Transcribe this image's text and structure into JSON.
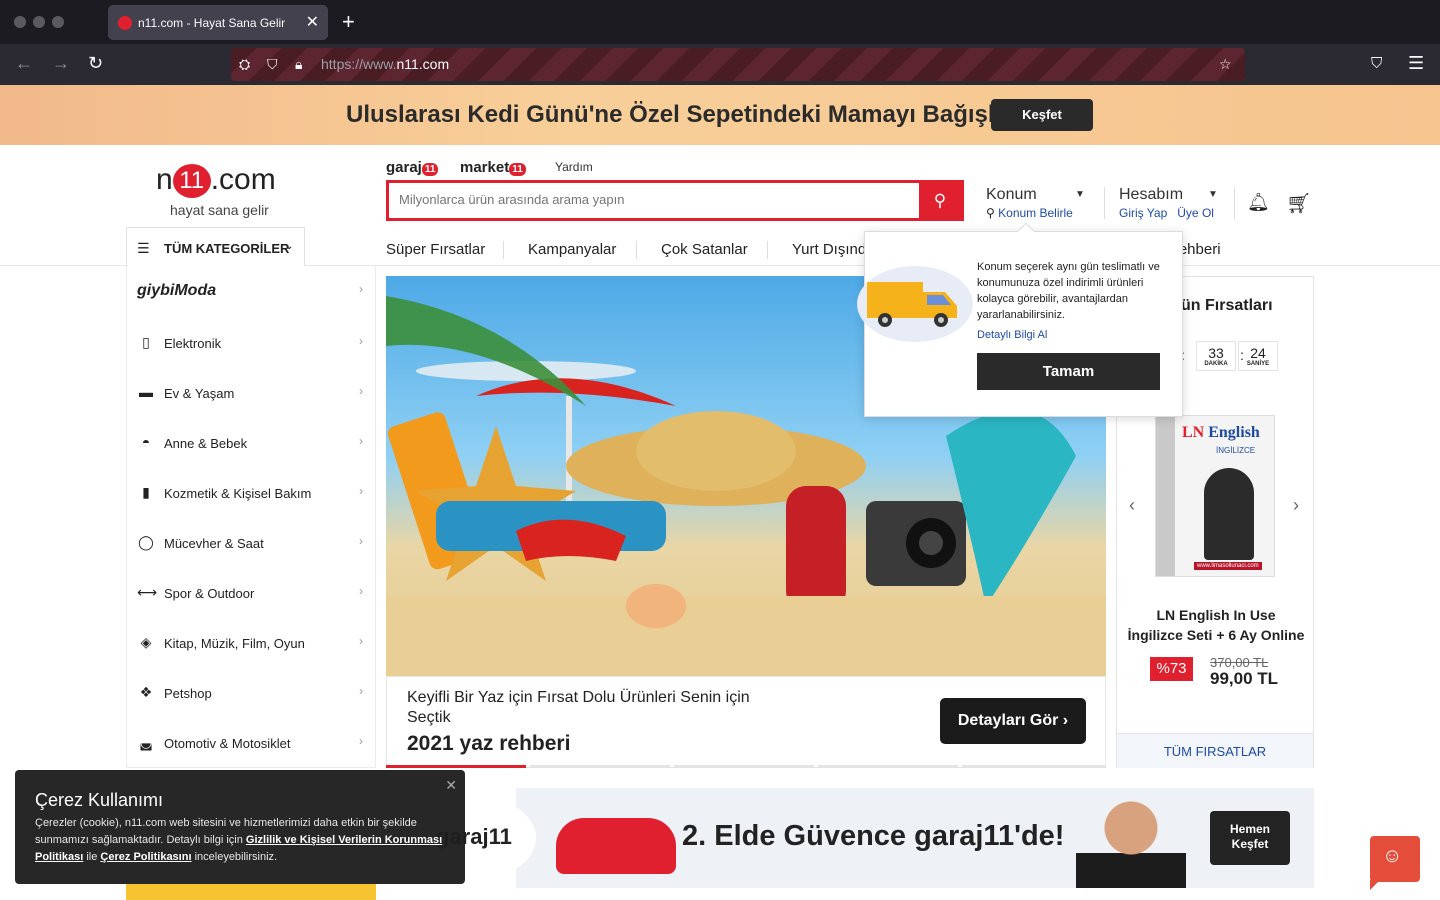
{
  "browser": {
    "tab_title": "n11.com - Hayat Sana Gelir",
    "url_prefix": "https://www.",
    "url_domain": "n11.com"
  },
  "promo": {
    "text": "Uluslarası Kedi Günü'ne Özel Sepetindeki Mamayı Bağışla",
    "button": "Keşfet"
  },
  "header": {
    "logo_left": "n",
    "logo_mid": "11",
    "logo_right": ".com",
    "slogan": "hayat sana gelir",
    "link_garaj": "garaj",
    "link_market": "market",
    "badge": "11",
    "link_yardim": "Yardım",
    "search_placeholder": "Milyonlarca ürün arasında arama yapın",
    "konum_title": "Konum",
    "konum_sub": "Konum Belirle",
    "hesap_title": "Hesabım",
    "hesap_login": "Giriş Yap",
    "hesap_signup": "Üye Ol",
    "all_categories": "TÜM KATEGORİLER",
    "nav": [
      "Süper Fırsatlar",
      "Kampanyalar",
      "Çok Satanlar",
      "Yurt Dışından",
      "Rehberi"
    ]
  },
  "categories": [
    {
      "label": "giybiModa",
      "icon": "giybi-logo"
    },
    {
      "label": "Elektronik",
      "icon": "phone-icon"
    },
    {
      "label": "Ev & Yaşam",
      "icon": "sofa-icon"
    },
    {
      "label": "Anne & Bebek",
      "icon": "stroller-icon"
    },
    {
      "label": "Kozmetik & Kişisel Bakım",
      "icon": "bottle-icon"
    },
    {
      "label": "Mücevher & Saat",
      "icon": "ring-icon"
    },
    {
      "label": "Spor & Outdoor",
      "icon": "dumbbell-icon"
    },
    {
      "label": "Kitap, Müzik, Film, Oyun",
      "icon": "gamepad-icon"
    },
    {
      "label": "Petshop",
      "icon": "paw-icon"
    },
    {
      "label": "Otomotiv & Motosiklet",
      "icon": "car-icon"
    }
  ],
  "hero": {
    "description": "Keyifli Bir Yaz için Fırsat Dolu Ürünleri Senin için Seçtik",
    "heading": "2021 yaz rehberi",
    "button": "Detayları Gör"
  },
  "deals": {
    "title": "ün Fırsatları",
    "minutes": "33",
    "minutes_label": "DAKİKA",
    "seconds": "24",
    "seconds_label": "SANİYE",
    "product_line1": "LN English In Use",
    "product_line2": "İngilizce Seti + 6 Ay Online",
    "discount": "%73",
    "old_price": "370,00 TL",
    "new_price": "99,00 TL",
    "all_link": "TÜM FIRSATLAR",
    "book_title_a": "LN",
    "book_title_b": " English",
    "book_sub": "İNGİLİZCE",
    "book_site": "www.limasollunaci.com"
  },
  "konum_popup": {
    "text": "Konum seçerek aynı gün teslimatlı ve konumunuza özel indirimli ürünleri kolayca görebilir, avantajlardan yararlanabilirsiniz.",
    "more": "Detaylı Bilgi Al",
    "ok": "Tamam"
  },
  "garaj_banner": {
    "logo": "garaj11",
    "text": "2. Elde Güvence garaj11'de!",
    "btn_line1": "Hemen",
    "btn_line2": "Keşfet"
  },
  "cookie": {
    "title": "Çerez Kullanımı",
    "body_pre": "Çerezler (cookie), n11.com web sitesini ve hizmetlerimizi daha etkin bir şekilde sunmamızı sağlamaktadır. Detaylı bilgi için ",
    "link1": "Gizlilik ve Kişisel Verilerin Korunması Politikası",
    "mid": " ile ",
    "link2": "Çerez Politikasını",
    "body_post": " inceleyebilirsiniz."
  }
}
